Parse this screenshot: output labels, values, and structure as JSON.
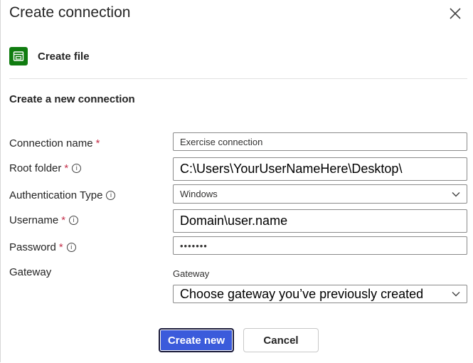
{
  "dialog": {
    "title": "Create connection",
    "file_label": "Create file",
    "section_title": "Create a new connection"
  },
  "form": {
    "connection_name": {
      "label": "Connection name",
      "required": "*",
      "value": "Exercise connection"
    },
    "root_folder": {
      "label": "Root folder",
      "required": "*",
      "value": "C:\\Users\\YourUserNameHere\\Desktop\\"
    },
    "auth_type": {
      "label": "Authentication Type",
      "value": "Windows"
    },
    "username": {
      "label": "Username",
      "required": "*",
      "value": "Domain\\user.name"
    },
    "password": {
      "label": "Password",
      "required": "*",
      "value": "•••••••"
    },
    "gateway": {
      "label": "Gateway",
      "sublabel": "Gateway",
      "value": "Choose gateway you’ve previously created"
    }
  },
  "buttons": {
    "create_new": "Create new",
    "cancel": "Cancel"
  },
  "icons": {
    "close": "close-icon",
    "file": "file-icon",
    "info": "info-icon",
    "chevron": "chevron-down-icon"
  },
  "colors": {
    "primary_button": "#3b5bdb",
    "file_icon_bg": "#107c10",
    "required": "#c4314b"
  }
}
